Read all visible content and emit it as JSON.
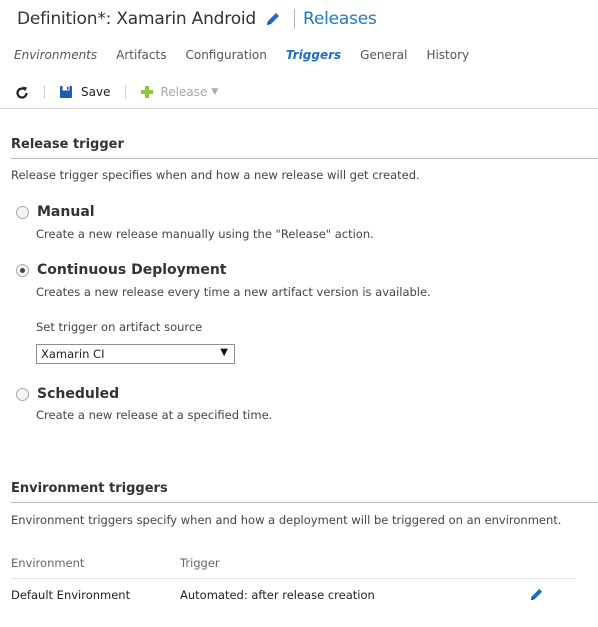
{
  "header": {
    "title": "Definition*: Xamarin Android",
    "releases_link": "Releases",
    "edit_icon": "pencil-icon"
  },
  "tabs": [
    {
      "label": "Environments",
      "active": false,
      "italic": true
    },
    {
      "label": "Artifacts",
      "active": false
    },
    {
      "label": "Configuration",
      "active": false
    },
    {
      "label": "Triggers",
      "active": true
    },
    {
      "label": "General",
      "active": false
    },
    {
      "label": "History",
      "active": false
    }
  ],
  "toolbar": {
    "refresh_icon": "refresh-icon",
    "save_label": "Save",
    "save_icon": "floppy-disk-icon",
    "release_label": "Release",
    "release_icon": "plus-icon"
  },
  "release_trigger": {
    "title": "Release trigger",
    "description": "Release trigger specifies when and how a new release will get created.",
    "options": [
      {
        "label": "Manual",
        "description": "Create a new release manually using the \"Release\" action.",
        "checked": false
      },
      {
        "label": "Continuous Deployment",
        "description": "Creates a new release every time a new artifact version is available.",
        "checked": true
      },
      {
        "label": "Scheduled",
        "description": "Create a new release at a specified time.",
        "checked": false
      }
    ],
    "artifact_label": "Set trigger on artifact source",
    "artifact_value": "Xamarin CI"
  },
  "environment_triggers": {
    "title": "Environment triggers",
    "description": "Environment triggers specify when and how a deployment will be triggered on an environment.",
    "columns": [
      "Environment",
      "Trigger"
    ],
    "rows": [
      {
        "environment": "Default Environment",
        "trigger": "Automated: after release creation"
      }
    ]
  },
  "colors": {
    "accent": "#1f7bc1",
    "active_tab": "#1f6fbf",
    "save_icon": "#1a5fa8",
    "release_plus": "#8dc63f"
  }
}
